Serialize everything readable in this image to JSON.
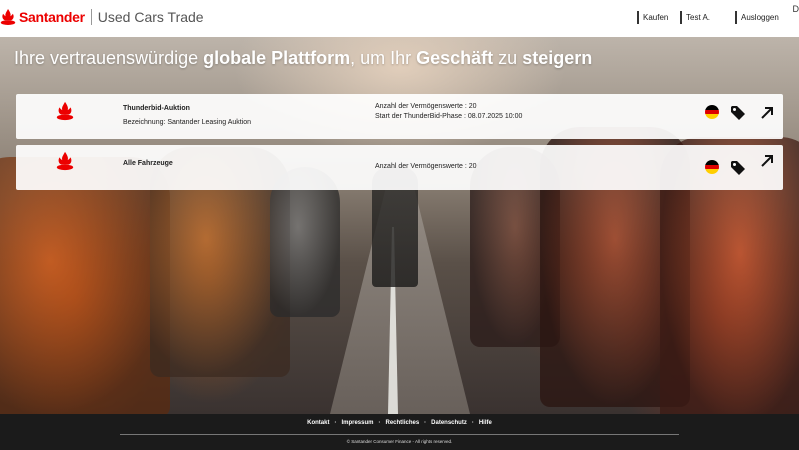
{
  "header": {
    "brand": "Santander",
    "app_name": "Used Cars Trade",
    "nav": {
      "buy": "Kaufen",
      "user": "Test A.",
      "logout": "Ausloggen"
    },
    "lang_cut": "D"
  },
  "hero": {
    "headline": {
      "p1": "Ihre vertrauenswürdige ",
      "b1": "globale Plattform",
      "p2": ", um Ihr ",
      "b2": "Geschäft",
      "p3": " zu ",
      "b3": "steigern"
    }
  },
  "cards": [
    {
      "title": "Thunderbid-Auktion",
      "subtitle": "Bezeichnung: Santander Leasing Auktion",
      "assets": "Anzahl der Vermögenswerte : 20",
      "start": "Start der ThunderBid-Phase : 08.07.2025 10:00",
      "flag": "germany-flag-icon"
    },
    {
      "title": "Alle Fahrzeuge",
      "assets": "Anzahl der Vermögenswerte : 20",
      "flag": "germany-flag-icon"
    }
  ],
  "footer": {
    "links": [
      "Kontakt",
      "Impressum",
      "Rechtliches",
      "Datenschutz",
      "Hilfe"
    ],
    "separator": "·",
    "copyright": "© Santander Consumer Finance - All rights reserved."
  },
  "colors": {
    "brand_red": "#ec0000",
    "footer_bg": "#1b1b1b",
    "flag_black": "#000000",
    "flag_red": "#dd0000",
    "flag_gold": "#ffce00"
  }
}
